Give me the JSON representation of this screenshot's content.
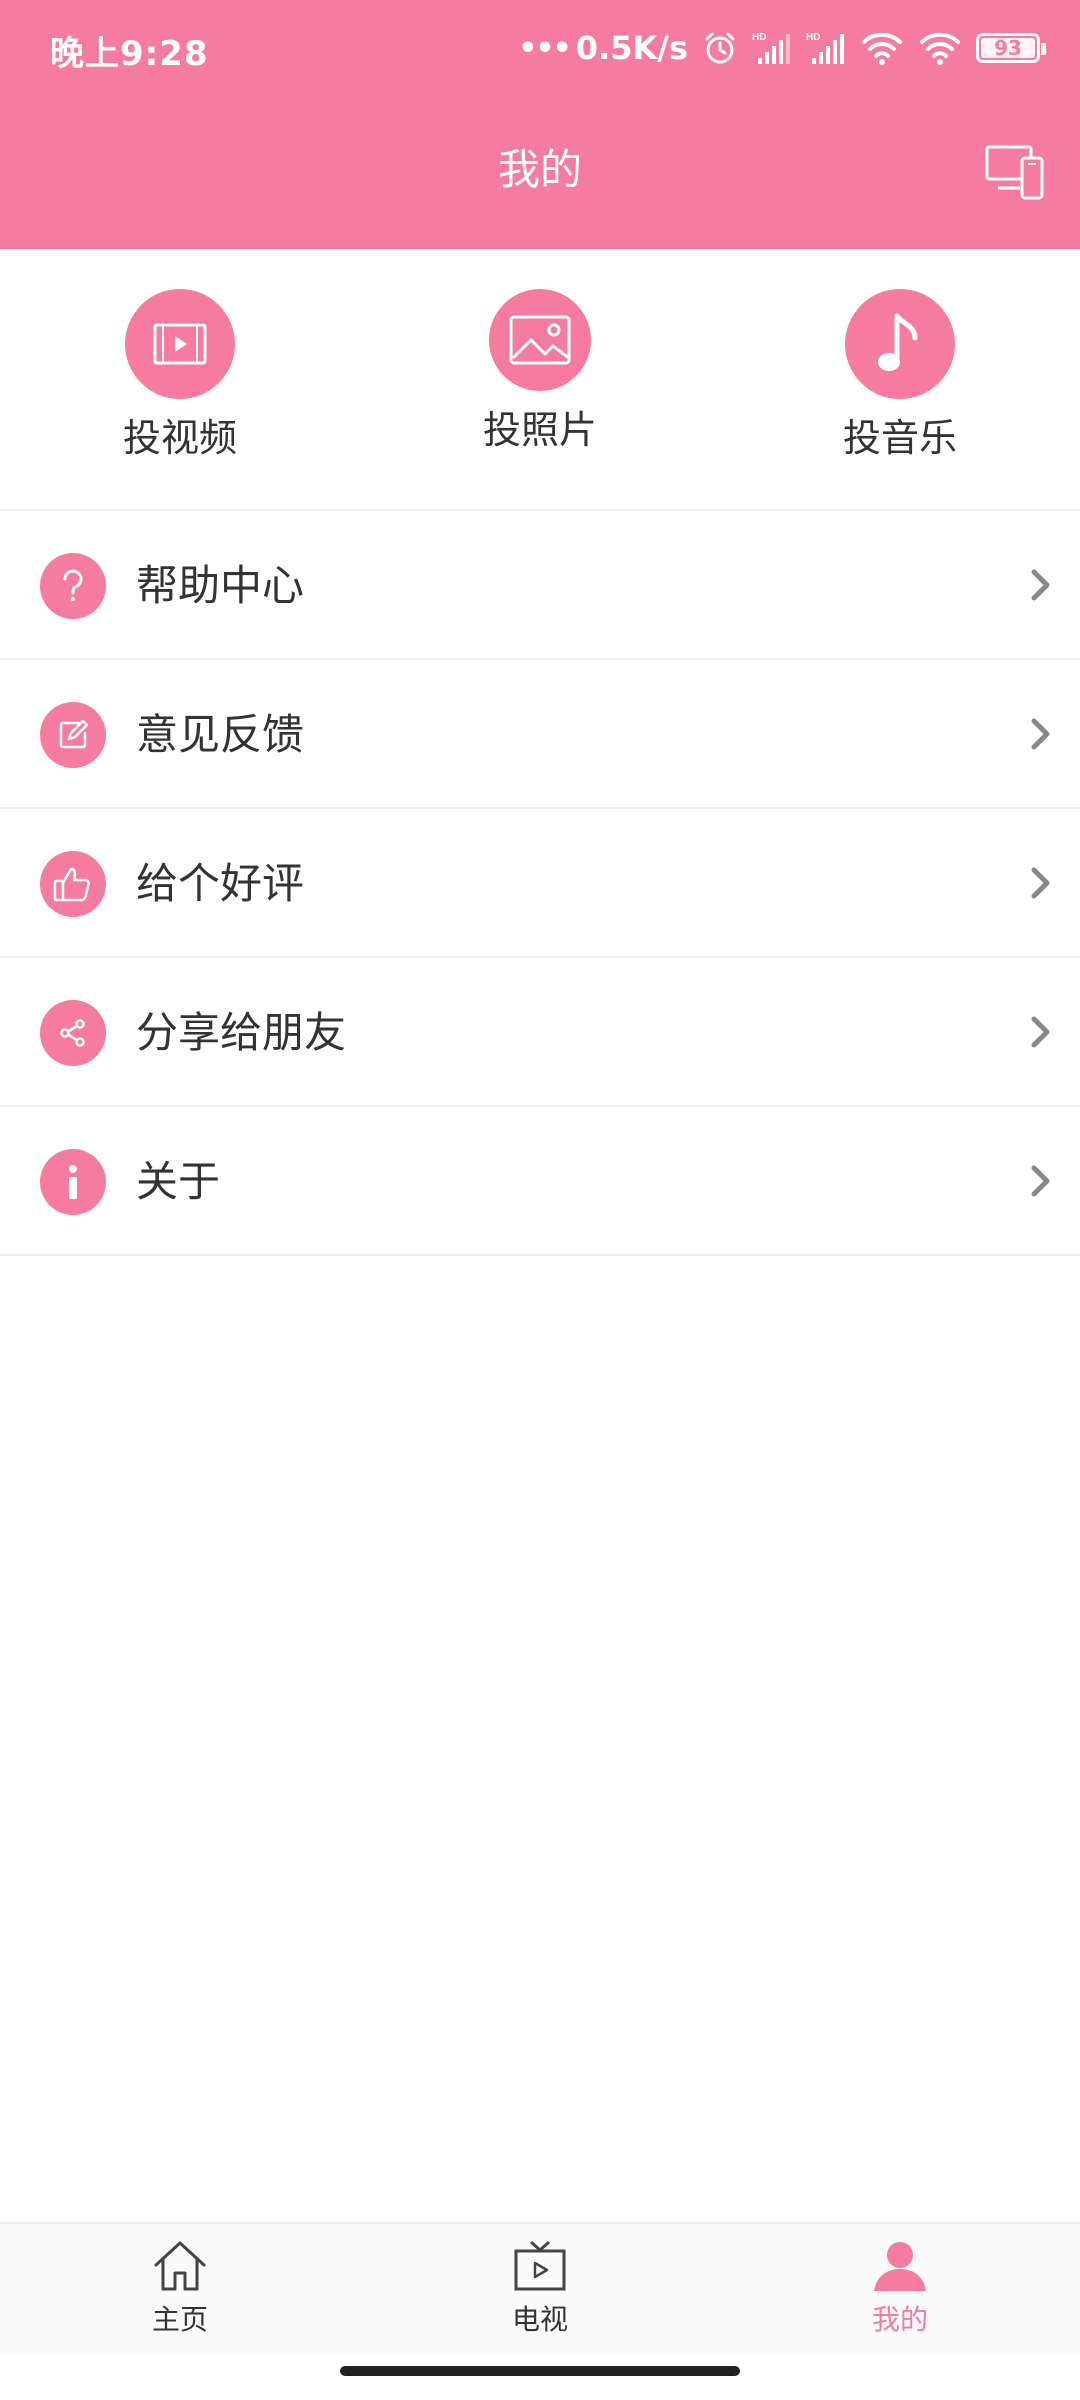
{
  "colors": {
    "accent": "#f57c9f",
    "text": "#333333",
    "chevron": "#888888",
    "divider": "#eeeeee"
  },
  "status_bar": {
    "time": "晚上9:28",
    "dots": "•••",
    "speed": "0.5K/s",
    "battery": "93"
  },
  "header": {
    "title": "我的",
    "device_icon": "screen-cast-devices-icon"
  },
  "quick_actions": [
    {
      "label": "投视频",
      "icon": "video-icon"
    },
    {
      "label": "投照片",
      "icon": "photo-icon"
    },
    {
      "label": "投音乐",
      "icon": "music-note-icon"
    }
  ],
  "menu": [
    {
      "label": "帮助中心",
      "icon": "help-icon"
    },
    {
      "label": "意见反馈",
      "icon": "edit-icon"
    },
    {
      "label": "给个好评",
      "icon": "thumbs-up-icon"
    },
    {
      "label": "分享给朋友",
      "icon": "share-icon"
    },
    {
      "label": "关于",
      "icon": "info-icon"
    }
  ],
  "bottom_nav": [
    {
      "label": "主页",
      "icon": "home-icon",
      "active": false
    },
    {
      "label": "电视",
      "icon": "tv-icon",
      "active": false
    },
    {
      "label": "我的",
      "icon": "user-icon",
      "active": true
    }
  ]
}
